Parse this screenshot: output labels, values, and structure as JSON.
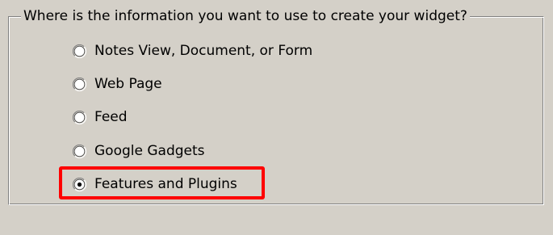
{
  "group": {
    "legend": "Where is the information you want to use to create your widget?"
  },
  "options": [
    {
      "label": "Notes View, Document, or Form",
      "selected": false
    },
    {
      "label": "Web Page",
      "selected": false
    },
    {
      "label": "Feed",
      "selected": false
    },
    {
      "label": "Google Gadgets",
      "selected": false
    },
    {
      "label": "Features and Plugins",
      "selected": true
    }
  ],
  "colors": {
    "dialog_background": "#d4d0c8",
    "highlight": "#ff0000"
  }
}
